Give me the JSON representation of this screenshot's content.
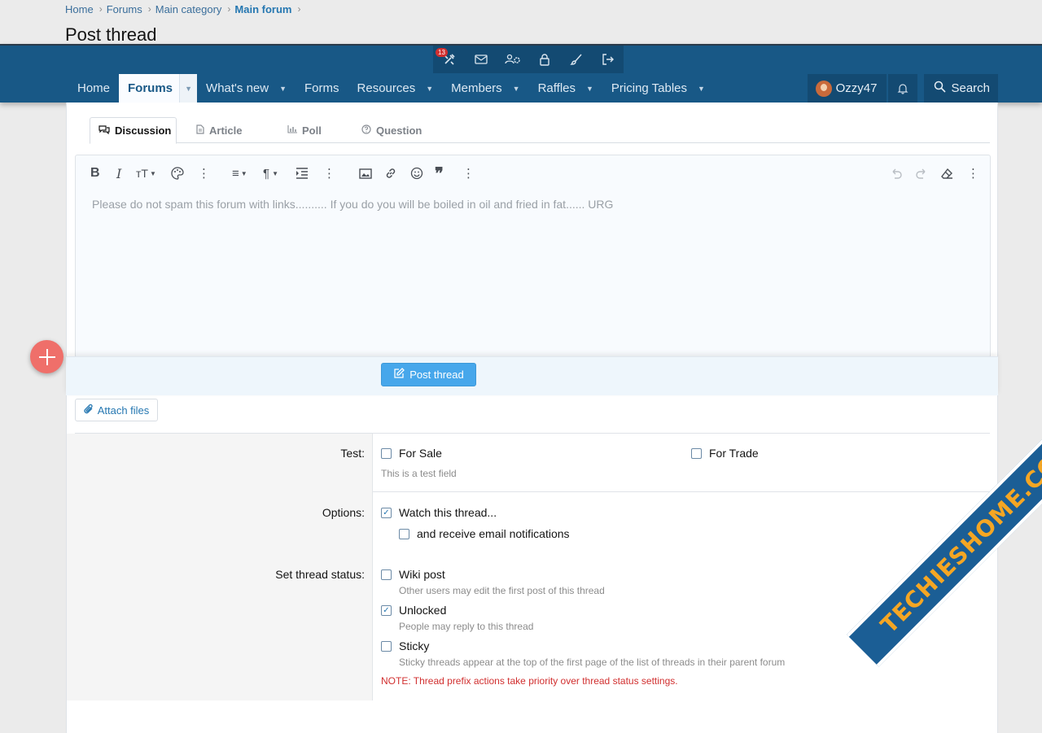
{
  "breadcrumb": [
    "Home",
    "Forums",
    "Main category",
    "Main forum"
  ],
  "page_title": "Post thread",
  "admin_bar": {
    "badge_count": "13",
    "icons": [
      "tools-icon",
      "mail-icon",
      "users-cog-icon",
      "lock-icon",
      "brush-icon",
      "logout-icon"
    ]
  },
  "nav": {
    "tabs": [
      {
        "label": "Home",
        "caret": false
      },
      {
        "label": "Forums",
        "caret": true,
        "active": true
      },
      {
        "label": "What's new",
        "caret": true
      },
      {
        "label": "Forms",
        "caret": false
      },
      {
        "label": "Resources",
        "caret": true
      },
      {
        "label": "Members",
        "caret": true
      },
      {
        "label": "Raffles",
        "caret": true
      },
      {
        "label": "Pricing Tables",
        "caret": true
      }
    ],
    "username": "Ozzy47",
    "search_label": "Search"
  },
  "type_tabs": [
    "Discussion",
    "Article",
    "Poll",
    "Question"
  ],
  "editor": {
    "placeholder": "Please do not spam this forum with links.......... If you do you will be boiled in oil and fried in fat...... URG"
  },
  "buttons": {
    "post_thread": "Post thread",
    "attach_files": "Attach files"
  },
  "form": {
    "test_label": "Test:",
    "test_options": [
      "For Sale",
      "For Trade"
    ],
    "test_hint": "This is a test field",
    "options_label": "Options:",
    "watch_label": "Watch this thread...",
    "email_label": "and receive email notifications",
    "status_label": "Set thread status:",
    "wiki_label": "Wiki post",
    "wiki_hint": "Other users may edit the first post of this thread",
    "unlocked_label": "Unlocked",
    "unlocked_hint": "People may reply to this thread",
    "sticky_label": "Sticky",
    "sticky_hint": "Sticky threads appear at the top of the first page of the list of threads in their parent forum",
    "note": "NOTE: Thread prefix actions take priority over thread status settings."
  },
  "checked": {
    "watch": true,
    "unlocked": true,
    "for_sale": false,
    "for_trade": false,
    "email": false,
    "wiki": false,
    "sticky": false
  },
  "watermark": "TECHIESHOME.COM",
  "colors": {
    "nav_bg": "#185886",
    "accent": "#2577b1",
    "button": "#47a7eb",
    "fab": "#ef6f6a",
    "note": "#d12f2f"
  }
}
